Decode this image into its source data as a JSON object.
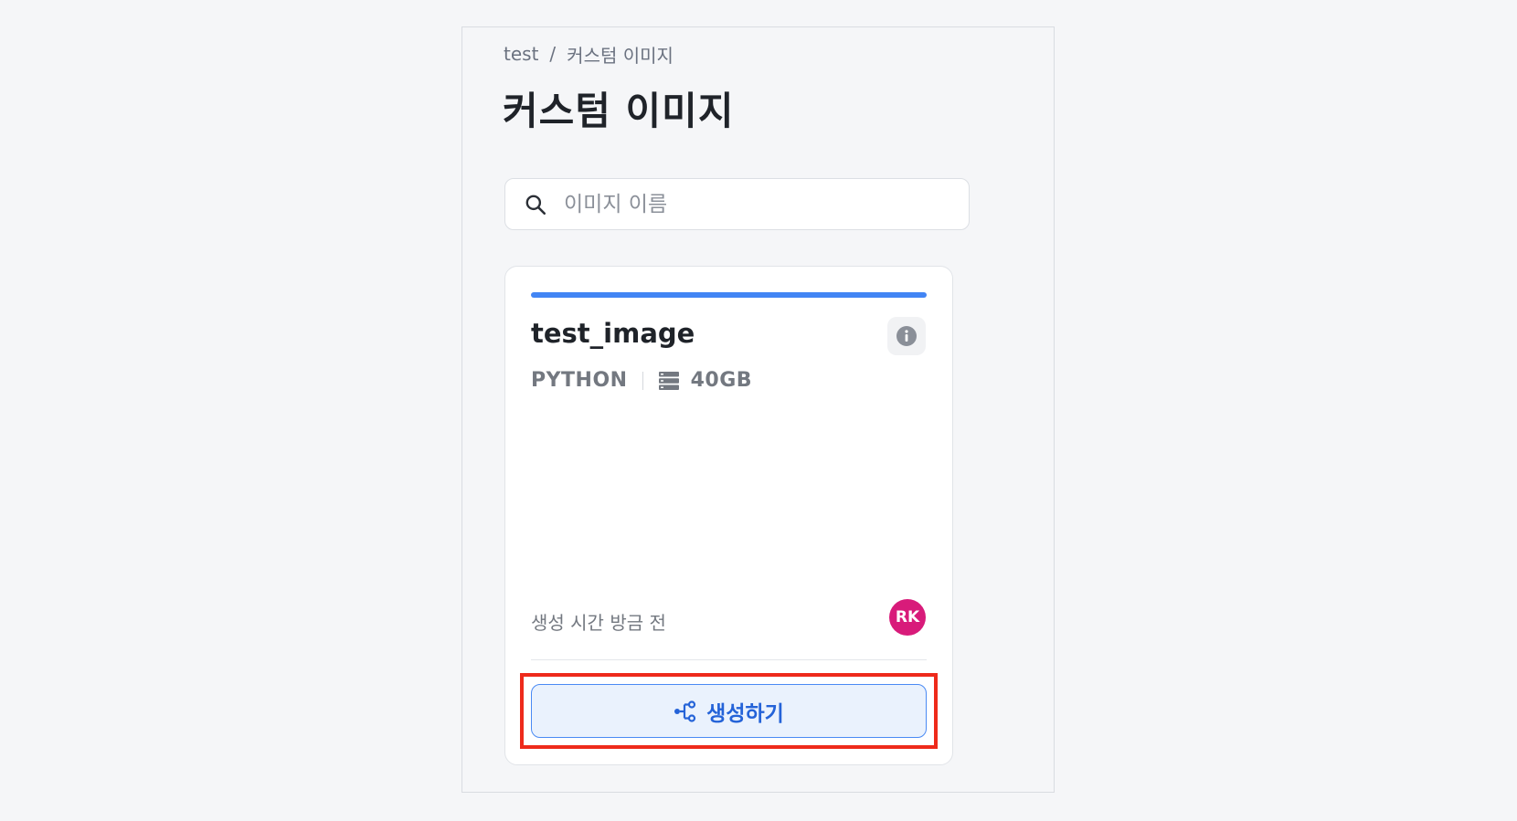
{
  "breadcrumb": {
    "parent": "test",
    "separator": "/",
    "current": "커스텀 이미지"
  },
  "page": {
    "title": "커스텀 이미지"
  },
  "search": {
    "placeholder": "이미지 이름",
    "value": ""
  },
  "image_card": {
    "name": "test_image",
    "language": "PYTHON",
    "storage": "40GB",
    "created_text": "생성 시간 방금 전",
    "owner_initials": "RK",
    "create_button_label": "생성하기",
    "status_color": "#4285f4",
    "avatar_color": "#d81b7a"
  },
  "icons": {
    "search": "search-icon",
    "info": "info-icon",
    "storage": "storage-icon",
    "create": "share-nodes-icon"
  }
}
